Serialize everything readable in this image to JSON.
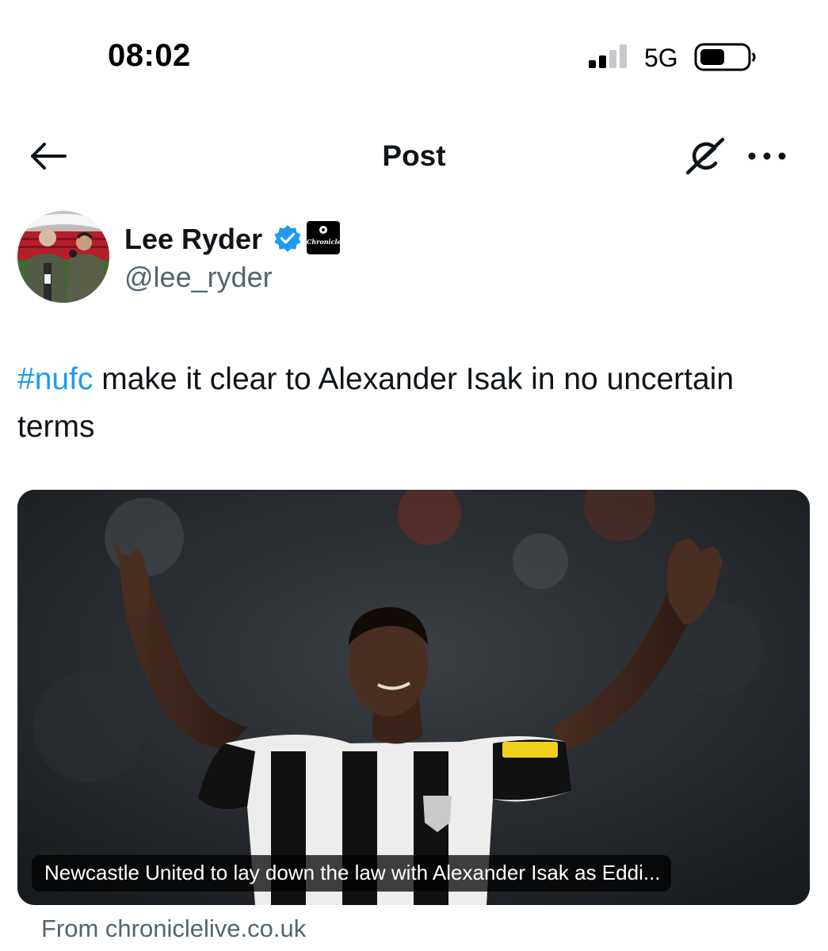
{
  "status_bar": {
    "time": "08:02",
    "network": "5G",
    "icons": [
      "signal-icon",
      "battery-icon"
    ]
  },
  "nav": {
    "title": "Post",
    "icons": [
      "back-arrow-icon",
      "grok-icon",
      "more-icon"
    ]
  },
  "author": {
    "name": "Lee Ryder",
    "handle": "@lee_ryder",
    "verified": true,
    "affiliation": "Chronicle",
    "icons": [
      "verified-icon"
    ]
  },
  "post": {
    "hashtag": "#nufc",
    "text": " make it clear to Alexander Isak in no uncertain terms"
  },
  "link_card": {
    "caption": "Newcastle United to lay down the law with Alexander Isak as Eddi...",
    "source": "From chroniclelive.co.uk"
  },
  "colors": {
    "link": "#1d9bf0",
    "secondary_text": "#536471",
    "primary_text": "#0f1419",
    "verified": "#1d9bf0"
  }
}
